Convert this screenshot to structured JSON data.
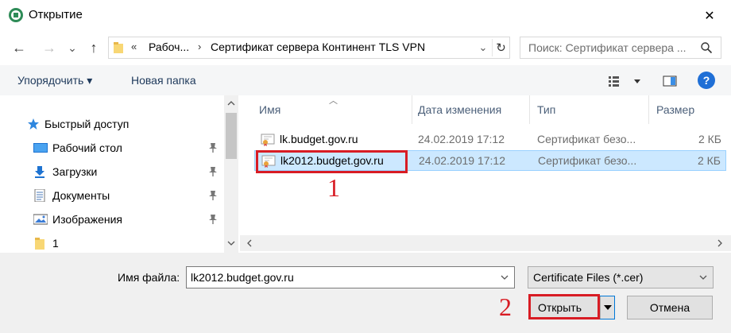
{
  "window": {
    "title": "Открытие",
    "close_glyph": "✕"
  },
  "nav": {
    "back_glyph": "←",
    "forward_glyph": "→",
    "recent_glyph": "⌄",
    "up_glyph": "↑"
  },
  "address": {
    "chevron": "«",
    "crumb1": "Рабоч...",
    "separator": "›",
    "crumb2": "Сертификат сервера Континент TLS VPN",
    "dropdown_glyph": "⌄",
    "refresh_glyph": "↻"
  },
  "search": {
    "placeholder": "Поиск: Сертификат сервера ..."
  },
  "toolbar": {
    "organize_label": "Упорядочить ▾",
    "new_folder_label": "Новая папка",
    "help_label": "?"
  },
  "sidebar": {
    "items": [
      {
        "label": "Быстрый доступ",
        "icon": "star-icon"
      },
      {
        "label": "Рабочий стол",
        "icon": "desktop-icon"
      },
      {
        "label": "Загрузки",
        "icon": "download-icon"
      },
      {
        "label": "Документы",
        "icon": "documents-icon"
      },
      {
        "label": "Изображения",
        "icon": "images-icon"
      },
      {
        "label": "1",
        "icon": "folder-icon"
      }
    ]
  },
  "columns": {
    "name": "Имя",
    "date": "Дата изменения",
    "type": "Тип",
    "size": "Размер"
  },
  "files": [
    {
      "name": "lk.budget.gov.ru",
      "date": "24.02.2019 17:12",
      "type": "Сертификат безо...",
      "size": "2 КБ"
    },
    {
      "name": "lk2012.budget.gov.ru",
      "date": "24.02.2019 17:12",
      "type": "Сертификат безо...",
      "size": "2 КБ"
    }
  ],
  "annotations": {
    "step1": "1",
    "step2": "2"
  },
  "bottom": {
    "filename_label": "Имя файла:",
    "filename_value": "lk2012.budget.gov.ru",
    "filetype_value": "Certificate Files (*.cer)",
    "open_label": "Открыть",
    "cancel_label": "Отмена"
  },
  "colors": {
    "accent": "#0078d7",
    "selection": "#cce8ff",
    "annotation": "#d81c24"
  }
}
